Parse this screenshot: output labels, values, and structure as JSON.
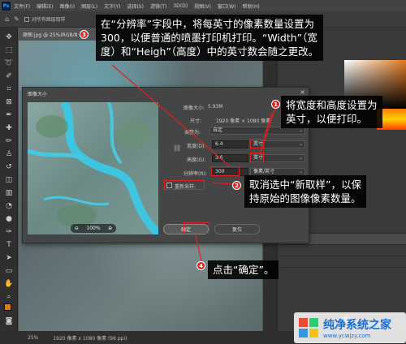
{
  "app": {
    "logo": "Ps"
  },
  "menu": [
    "文件(F)",
    "编辑(E)",
    "图像(I)",
    "图层(L)",
    "文字(Y)",
    "选择(S)",
    "滤镜(T)",
    "3D(D)",
    "视图(V)",
    "窗口(W)",
    "帮助(H)"
  ],
  "options_bar": {
    "checkbox_label": "对所有图层取样"
  },
  "doc_tab": {
    "label": "原图.jpg @ 25%(RGB/8",
    "close": "×"
  },
  "status": {
    "zoom": "25%",
    "info": "1920 像素 x 1080 像素 (96 ppi)"
  },
  "dialog": {
    "title": "图像大小",
    "close": "×",
    "image_size_label": "图像大小:",
    "image_size_value": "5.93M",
    "dimensions_label": "尺寸:",
    "dimensions_value": "1920 像素 × 1080 像素",
    "fit_label": "调整为:",
    "fit_value": "自定",
    "width_label": "宽度(D):",
    "width_value": "6.4",
    "width_unit": "英寸",
    "height_label": "高度(G):",
    "height_value": "3.6",
    "height_unit": "英寸",
    "resolution_label": "分辨率(R):",
    "resolution_value": "300",
    "resolution_unit": "像素/英寸",
    "resample_label": "重新采样:",
    "resample_value": "",
    "ok_button": "确定",
    "reset_button": "复位",
    "preview_zoom": "100%",
    "preview_minus": "⊖",
    "preview_plus": "⊕"
  },
  "callouts": {
    "c1_text_line1": "在“分辨率”字段中，将每英寸的像素数量设置为",
    "c1_text_line2": "300，以便普通的喷墨打印机打印。“Width”（宽",
    "c1_text_line3": "度）和“Heigh”（高度）中的英寸数会随之更改。",
    "c2_text_line1": "将宽度和高度设置为",
    "c2_text_line2": "英寸，以便打印。",
    "c3_text_line1": "取消选中“新取样”，以保",
    "c3_text_line2": "持原始的图像像素数量。",
    "c4_text": "点击“确定”。"
  },
  "badges": {
    "b1": "1",
    "b2": "2",
    "b3": "3",
    "b4": "4"
  },
  "watermark": {
    "title": "纯净系统之家",
    "url": "www.ycwjzy.com"
  },
  "colors": {
    "annotation_red": "#e02020",
    "callout_bg": "#111111",
    "ps_panel": "#3a3a3a",
    "watermark_blue": "#1a6fd1"
  }
}
